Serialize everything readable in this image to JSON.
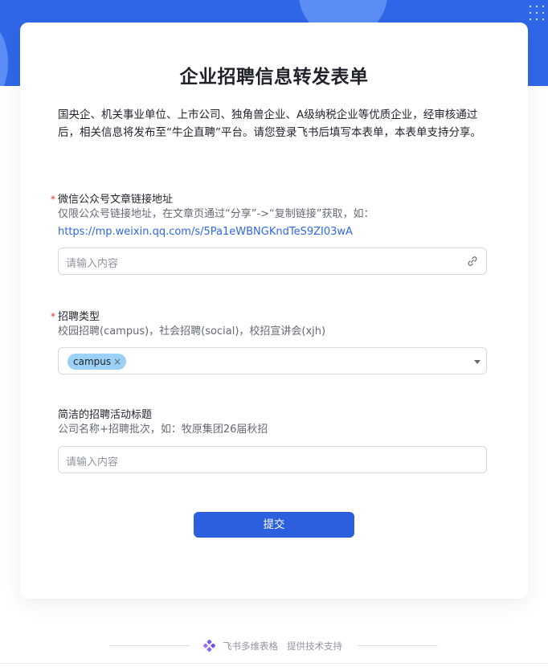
{
  "form": {
    "title": "企业招聘信息转发表单",
    "intro": "国央企、机关事业单位、上市公司、独角兽企业、A级纳税企业等优质企业，经审核通过后，相关信息将发布至“牛企直聘”平台。请您登录飞书后填写本表单，本表单支持分享。"
  },
  "fields": {
    "article_link": {
      "label": "微信公众号文章链接地址",
      "required_mark": "*",
      "desc": "仅限公众号链接地址，在文章页通过“分享”->“复制链接”获取，如：",
      "example_link": "https://mp.weixin.qq.com/s/5Pa1eWBNGKndTeS9ZI03wA",
      "placeholder": "请输入内容",
      "icon": "link-icon"
    },
    "recruit_type": {
      "label": "招聘类型",
      "required_mark": "*",
      "desc": "校园招聘(campus)，社会招聘(social)，校招宣讲会(xjh)",
      "selected": "campus",
      "remove_glyph": "×",
      "icon": "chevron-down-icon"
    },
    "activity_title": {
      "label": "简洁的招聘活动标题",
      "desc": "公司名称+招聘批次，如：牧原集团26届秋招",
      "placeholder": "请输入内容"
    }
  },
  "submit_label": "提交",
  "footer": {
    "brand": "飞书多维表格",
    "powered": "提供技术支持",
    "icon": "feishu-base-logo-icon"
  },
  "colors": {
    "primary": "#2f67e8",
    "button": "#2c5fde",
    "required": "#d83931",
    "tag_bg": "#9bd1f7"
  }
}
